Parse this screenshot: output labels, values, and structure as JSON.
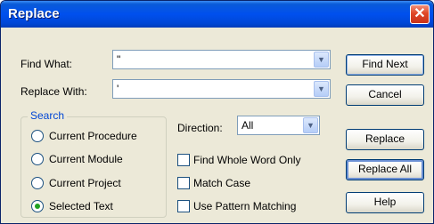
{
  "dialog": {
    "title": "Replace",
    "close_symbol": "✕",
    "find_what_label": "Find What:",
    "find_what_value": "\"",
    "replace_with_label": "Replace With:",
    "replace_with_value": "'",
    "direction_label": "Direction:",
    "direction_value": "All",
    "dropdown_arrow": "▼"
  },
  "search_group": {
    "legend": "Search",
    "options": [
      {
        "label": "Current Procedure",
        "selected": false
      },
      {
        "label": "Current Module",
        "selected": false
      },
      {
        "label": "Current Project",
        "selected": false
      },
      {
        "label": "Selected Text",
        "selected": true
      }
    ]
  },
  "checkboxes": [
    {
      "label": "Find Whole Word Only",
      "checked": false
    },
    {
      "label": "Match Case",
      "checked": false
    },
    {
      "label": "Use Pattern Matching",
      "checked": false
    }
  ],
  "buttons": {
    "find_next": "Find Next",
    "cancel": "Cancel",
    "replace": "Replace",
    "replace_all": "Replace All",
    "help": "Help"
  },
  "colors": {
    "titlebar": "#0050ee",
    "dialog_bg": "#ece9d8",
    "group_legend": "#0046d5",
    "radio_selected": "#21a121"
  }
}
